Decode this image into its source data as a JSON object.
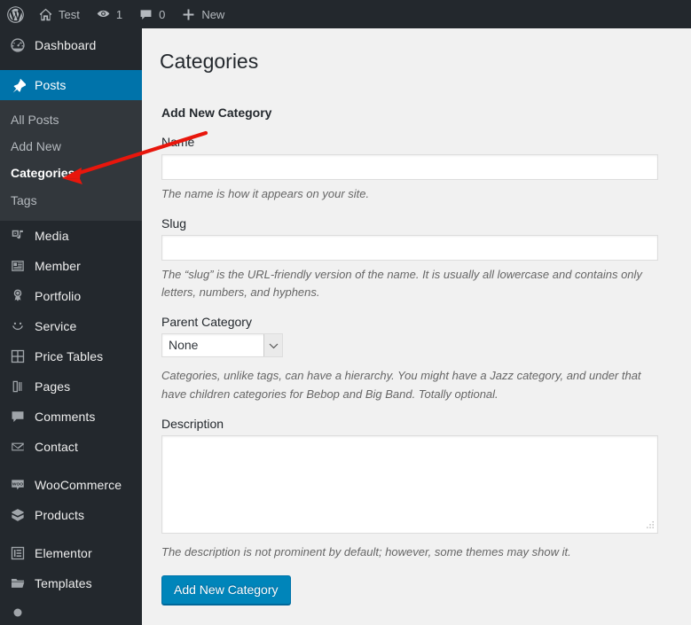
{
  "colors": {
    "adminbar_bg": "#23282d",
    "sidebar_bg": "#23282d",
    "submenu_bg": "#32373c",
    "active_blue": "#0073aa",
    "button_blue": "#0085ba",
    "content_bg": "#f1f1f1",
    "annotation_red": "#e8160c"
  },
  "adminbar": {
    "items": [
      {
        "icon": "wordpress-logo-icon",
        "label": ""
      },
      {
        "icon": "home-icon",
        "label": "Test"
      },
      {
        "icon": "updates-icon",
        "label": "1"
      },
      {
        "icon": "comment-bubble-icon",
        "label": "0"
      },
      {
        "icon": "plus-icon",
        "label": "New"
      }
    ]
  },
  "sidebar": {
    "items": [
      {
        "label": "Dashboard",
        "icon": "dashboard-icon",
        "current": false
      },
      {
        "label": "Posts",
        "icon": "pushpin-icon",
        "current": true
      },
      {
        "label": "Media",
        "icon": "media-icon",
        "current": false
      },
      {
        "label": "Member",
        "icon": "member-card-icon",
        "current": false
      },
      {
        "label": "Portfolio",
        "icon": "award-ribbon-icon",
        "current": false
      },
      {
        "label": "Service",
        "icon": "smiley-face-icon",
        "current": false
      },
      {
        "label": "Price Tables",
        "icon": "grid-table-icon",
        "current": false
      },
      {
        "label": "Pages",
        "icon": "pages-icon",
        "current": false
      },
      {
        "label": "Comments",
        "icon": "comment-bubble-icon",
        "current": false
      },
      {
        "label": "Contact",
        "icon": "envelope-icon",
        "current": false
      },
      {
        "label": "WooCommerce",
        "icon": "woocommerce-icon",
        "current": false
      },
      {
        "label": "Products",
        "icon": "product-box-icon",
        "current": false
      },
      {
        "label": "Elementor",
        "icon": "elementor-icon",
        "current": false
      },
      {
        "label": "Templates",
        "icon": "folder-icon",
        "current": false
      }
    ],
    "submenu": [
      {
        "label": "All Posts",
        "current": false
      },
      {
        "label": "Add New",
        "current": false
      },
      {
        "label": "Categories",
        "current": true
      },
      {
        "label": "Tags",
        "current": false
      }
    ]
  },
  "page": {
    "title": "Categories",
    "form_heading": "Add New Category",
    "fields": {
      "name": {
        "label": "Name",
        "value": "",
        "placeholder": "",
        "help": "The name is how it appears on your site."
      },
      "slug": {
        "label": "Slug",
        "value": "",
        "placeholder": "",
        "help": "The “slug” is the URL-friendly version of the name. It is usually all lowercase and contains only letters, numbers, and hyphens."
      },
      "parent": {
        "label": "Parent Category",
        "value": "None",
        "options": [
          "None"
        ],
        "help": "Categories, unlike tags, can have a hierarchy. You might have a Jazz category, and under that have children categories for Bebop and Big Band. Totally optional."
      },
      "description": {
        "label": "Description",
        "value": "",
        "placeholder": "",
        "help": "The description is not prominent by default; however, some themes may show it."
      }
    },
    "submit_label": "Add New Category"
  },
  "annotation": {
    "type": "arrow",
    "color": "#e8160c",
    "points_to": "sidebar-submenu-item-categories"
  }
}
